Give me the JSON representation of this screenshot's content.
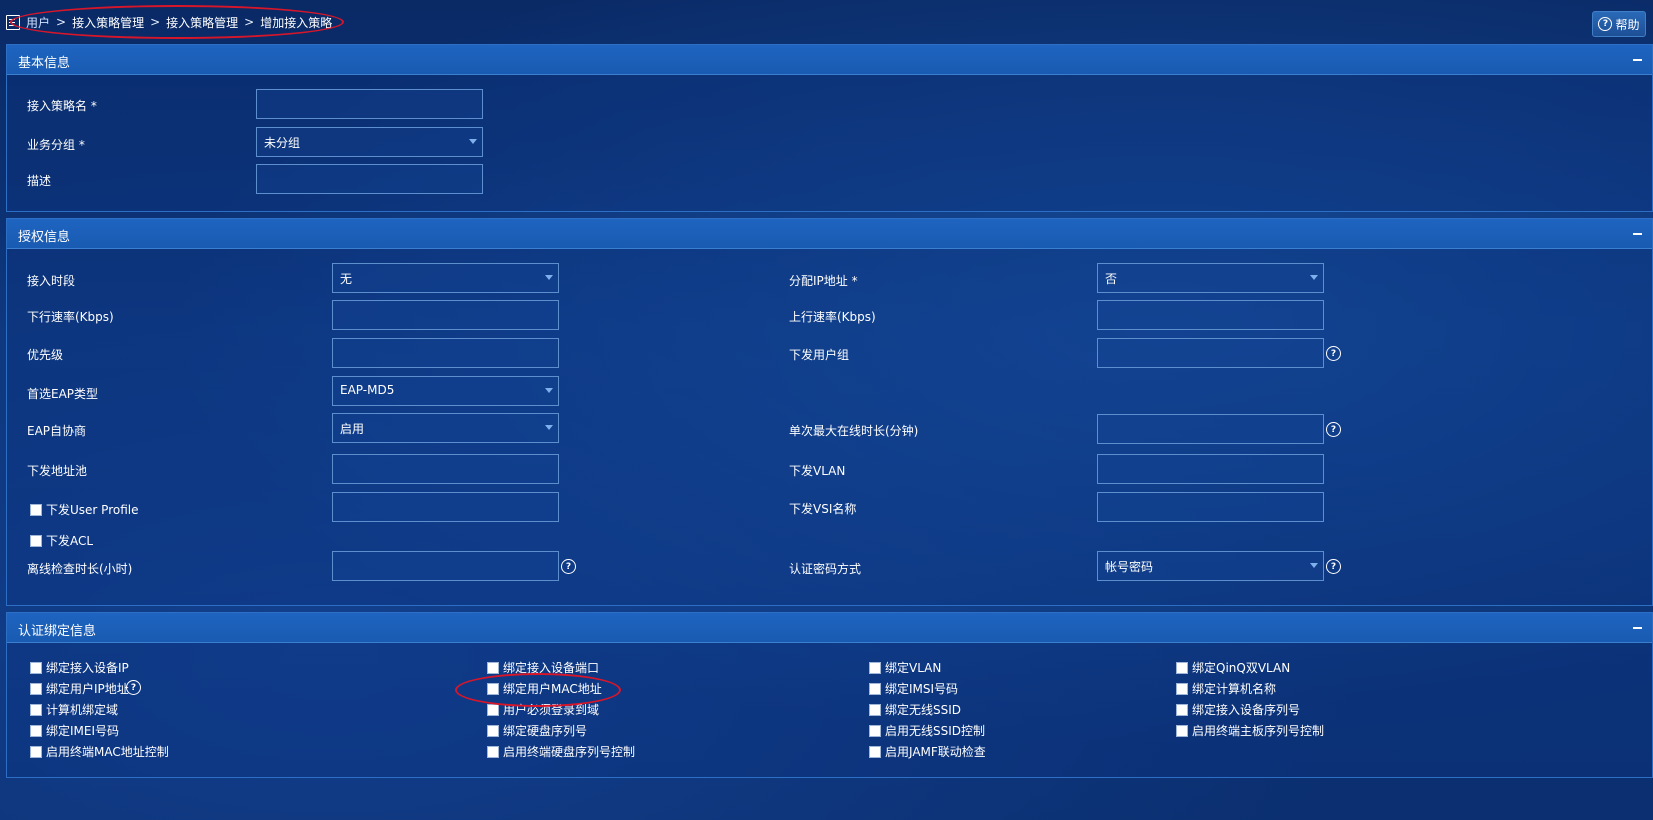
{
  "breadcrumb": {
    "items": [
      "用户",
      "接入策略管理",
      "接入策略管理",
      "增加接入策略"
    ],
    "separator": ">"
  },
  "help": {
    "label": "帮助"
  },
  "basic": {
    "title": "基本信息",
    "policy_name_label": "接入策略名 *",
    "policy_name_value": "",
    "group_label": "业务分组 *",
    "group_value": "未分组",
    "desc_label": "描述",
    "desc_value": ""
  },
  "auth": {
    "title": "授权信息",
    "access_period_label": "接入时段",
    "access_period_value": "无",
    "assign_ip_label": "分配IP地址 *",
    "assign_ip_value": "否",
    "down_rate_label": "下行速率(Kbps)",
    "up_rate_label": "上行速率(Kbps)",
    "priority_label": "优先级",
    "user_group_label": "下发用户组",
    "eap_type_label": "首选EAP类型",
    "eap_type_value": "EAP-MD5",
    "eap_nego_label": "EAP自协商",
    "eap_nego_value": "启用",
    "max_online_label": "单次最大在线时长(分钟)",
    "addr_pool_label": "下发地址池",
    "vlan_label": "下发VLAN",
    "user_profile_label": "下发User Profile",
    "vsi_label": "下发VSI名称",
    "acl_label": "下发ACL",
    "offline_check_label": "离线检查时长(小时)",
    "pwd_method_label": "认证密码方式",
    "pwd_method_value": "帐号密码"
  },
  "binding": {
    "title": "认证绑定信息",
    "columns": [
      [
        "绑定接入设备IP",
        "绑定用户IP地址",
        "计算机绑定域",
        "绑定IMEI号码",
        "启用终端MAC地址控制"
      ],
      [
        "绑定接入设备端口",
        "绑定用户MAC地址",
        "用户必须登录到域",
        "绑定硬盘序列号",
        "启用终端硬盘序列号控制"
      ],
      [
        "绑定VLAN",
        "绑定IMSI号码",
        "绑定无线SSID",
        "启用无线SSID控制",
        "启用JAMF联动检查"
      ],
      [
        "绑定QinQ双VLAN",
        "绑定计算机名称",
        "绑定接入设备序列号",
        "启用终端主板序列号控制"
      ]
    ]
  },
  "colors": {
    "accent": "#1e64c0",
    "highlight_oval": "#d8162a"
  }
}
